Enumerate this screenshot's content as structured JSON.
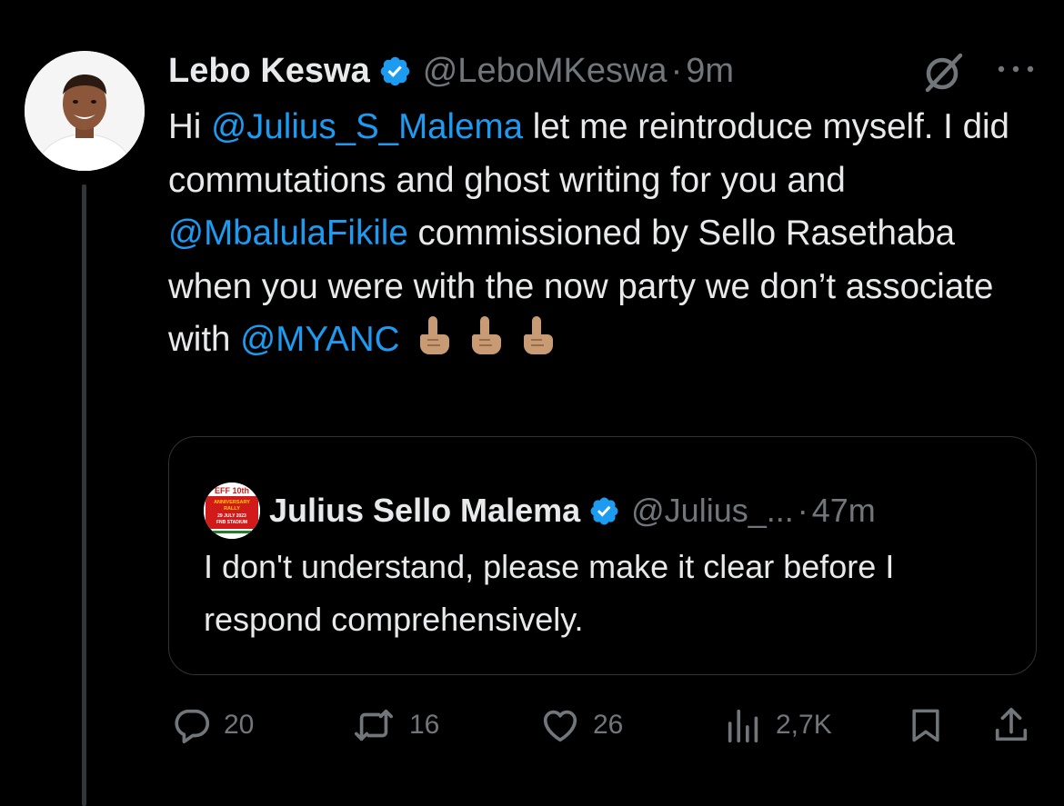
{
  "author": {
    "name": "Lebo Keswa",
    "handle": "@LeboMKeswa",
    "time": "9m"
  },
  "tweet": {
    "segments": [
      {
        "text": "Hi ",
        "mention": false
      },
      {
        "text": "@Julius_S_Malema",
        "mention": true
      },
      {
        "text": " let me reintroduce myself. I did commutations and ghost writing for you and ",
        "mention": false
      },
      {
        "text": "@MbalulaFikile",
        "mention": true
      },
      {
        "text": " commissioned by Sello Rasethaba when you were with the now party we don’t associate with ",
        "mention": false
      },
      {
        "text": "@MYANC",
        "mention": true
      }
    ],
    "emojis": [
      "index-pointing-up",
      "index-pointing-up",
      "index-pointing-up"
    ]
  },
  "quote": {
    "name": "Julius Sello Malema",
    "handle": "@Julius_...",
    "time": "47m",
    "text": "I don't understand, please make it clear before I respond comprehensively.",
    "avatar_text": [
      "EFF 10th",
      "ANNIVERSARY",
      "RALLY",
      "29 JULY 2023",
      "FNB STADIUM"
    ]
  },
  "actions": {
    "replies": "20",
    "reposts": "16",
    "likes": "26",
    "views": "2,7K"
  },
  "colors": {
    "background": "#000000",
    "text": "#e7e9ea",
    "secondary": "#71767b",
    "accent": "#1d9bf0",
    "border": "#2f3336",
    "skin_tone": "#c99b74"
  },
  "icons": [
    "verified-badge-icon",
    "grok-icon",
    "more-icon",
    "reply-icon",
    "repost-icon",
    "like-icon",
    "views-icon",
    "bookmark-icon",
    "share-icon"
  ]
}
